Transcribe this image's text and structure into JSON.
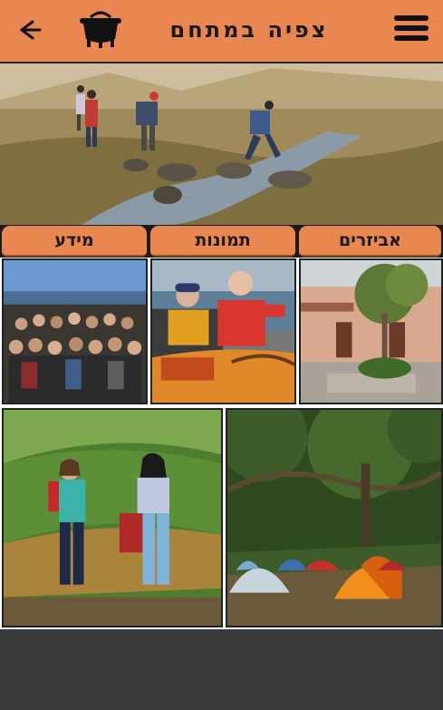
{
  "header": {
    "title": "צפיה במתחם",
    "back_icon": "arrow-left-icon",
    "logo_icon": "cooking-pot-icon",
    "menu_icon": "hamburger-menu-icon"
  },
  "hero": {
    "subject": "hikers crossing a stream in a valley"
  },
  "tabs": [
    {
      "label": "מידע"
    },
    {
      "label": "תמונות"
    },
    {
      "label": "אביזרים"
    }
  ],
  "gallery": [
    {
      "subject": "large group of youth by the sea"
    },
    {
      "subject": "kayakers in life jackets"
    },
    {
      "subject": "courtyard with tree and buildings"
    },
    {
      "subject": "two women hiking on green hills"
    },
    {
      "subject": "camping tents under trees"
    }
  ],
  "colors": {
    "accent": "#e8874f",
    "background": "#3a3a3a",
    "ink": "#1a1a1a"
  }
}
